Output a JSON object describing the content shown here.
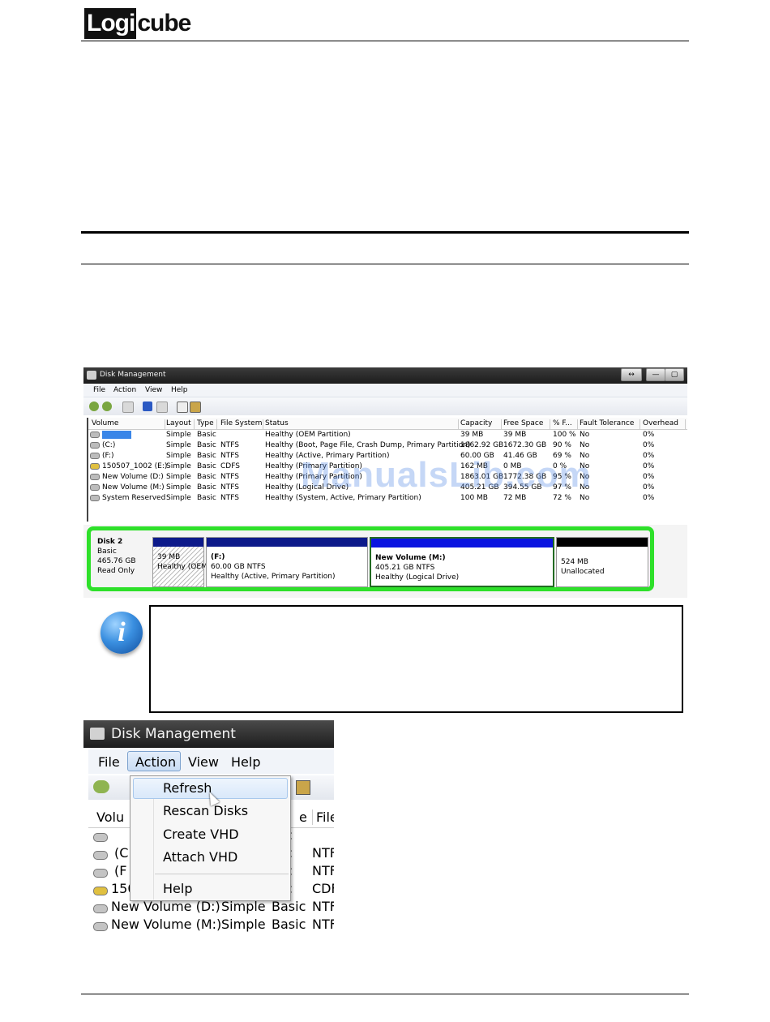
{
  "header": {
    "logo_part1": "Logi",
    "logo_part2": "cube"
  },
  "screenshot1": {
    "title": "Disk Management",
    "window_buttons": [
      "↔",
      "—",
      "▢"
    ],
    "menu": [
      "File",
      "Action",
      "View",
      "Help"
    ],
    "columns": [
      "Volume",
      "Layout",
      "Type",
      "File System",
      "Status",
      "Capacity",
      "Free Space",
      "% F...",
      "Fault Tolerance",
      "Overhead"
    ],
    "rows": [
      [
        "",
        "Simple",
        "Basic",
        "",
        "Healthy (OEM Partition)",
        "39 MB",
        "39 MB",
        "100 %",
        "No",
        "0%"
      ],
      [
        "(C:)",
        "Simple",
        "Basic",
        "NTFS",
        "Healthy (Boot, Page File, Crash Dump, Primary Partition)",
        "1862.92 GB",
        "1672.30 GB",
        "90 %",
        "No",
        "0%"
      ],
      [
        "(F:)",
        "Simple",
        "Basic",
        "NTFS",
        "Healthy (Active, Primary Partition)",
        "60.00 GB",
        "41.46 GB",
        "69 %",
        "No",
        "0%"
      ],
      [
        "150507_1002 (E:)",
        "Simple",
        "Basic",
        "CDFS",
        "Healthy (Primary Partition)",
        "162 MB",
        "0 MB",
        "0 %",
        "No",
        "0%"
      ],
      [
        "New Volume (D:)",
        "Simple",
        "Basic",
        "NTFS",
        "Healthy (Primary Partition)",
        "1863.01 GB",
        "1772.38 GB",
        "95 %",
        "No",
        "0%"
      ],
      [
        "New Volume (M:)",
        "Simple",
        "Basic",
        "NTFS",
        "Healthy (Logical Drive)",
        "405.21 GB",
        "394.55 GB",
        "97 %",
        "No",
        "0%"
      ],
      [
        "System Reserved",
        "Simple",
        "Basic",
        "NTFS",
        "Healthy (System, Active, Primary Partition)",
        "100 MB",
        "72 MB",
        "72 %",
        "No",
        "0%"
      ]
    ],
    "disk": {
      "name": "Disk 2",
      "type": "Basic",
      "size": "465.76 GB",
      "state": "Read Only",
      "partitions": [
        {
          "title": "",
          "line1": "39 MB",
          "line2": "Healthy (OEM",
          "color": "#0d1a8a"
        },
        {
          "title": "(F:)",
          "line1": "60.00 GB NTFS",
          "line2": "Healthy (Active, Primary Partition)",
          "color": "#0d1a8a"
        },
        {
          "title": "New Volume  (M:)",
          "line1": "405.21 GB NTFS",
          "line2": "Healthy (Logical Drive)",
          "color": "#0a14e0"
        },
        {
          "title": "",
          "line1": "524 MB",
          "line2": "Unallocated",
          "color": "#000000"
        }
      ]
    },
    "watermark": "ManualsLib.com"
  },
  "note": {
    "icon_glyph": "i"
  },
  "screenshot2": {
    "title": "Disk Management",
    "menu": [
      "File",
      "Action",
      "View",
      "Help"
    ],
    "header_left": "Volu",
    "header_mid": "e",
    "header_right": "File",
    "rows": [
      {
        "vol": "",
        "layout": "",
        "type": "sic",
        "fs": ""
      },
      {
        "vol": "(C",
        "layout": "",
        "type": "sic",
        "fs": "NTF"
      },
      {
        "vol": "(F",
        "layout": "",
        "type": "sic",
        "fs": "NTF"
      },
      {
        "vol": "150",
        "layout": "",
        "type": "sic",
        "fs": "CDF"
      },
      {
        "vol": "New Volume (D:)",
        "layout": "Simple",
        "type": "Basic",
        "fs": "NTF"
      },
      {
        "vol": "New Volume (M:)",
        "layout": "Simple",
        "type": "Basic",
        "fs": "NTF"
      }
    ],
    "dropdown": [
      "Refresh",
      "Rescan Disks",
      "Create VHD",
      "Attach VHD",
      "Help"
    ]
  }
}
